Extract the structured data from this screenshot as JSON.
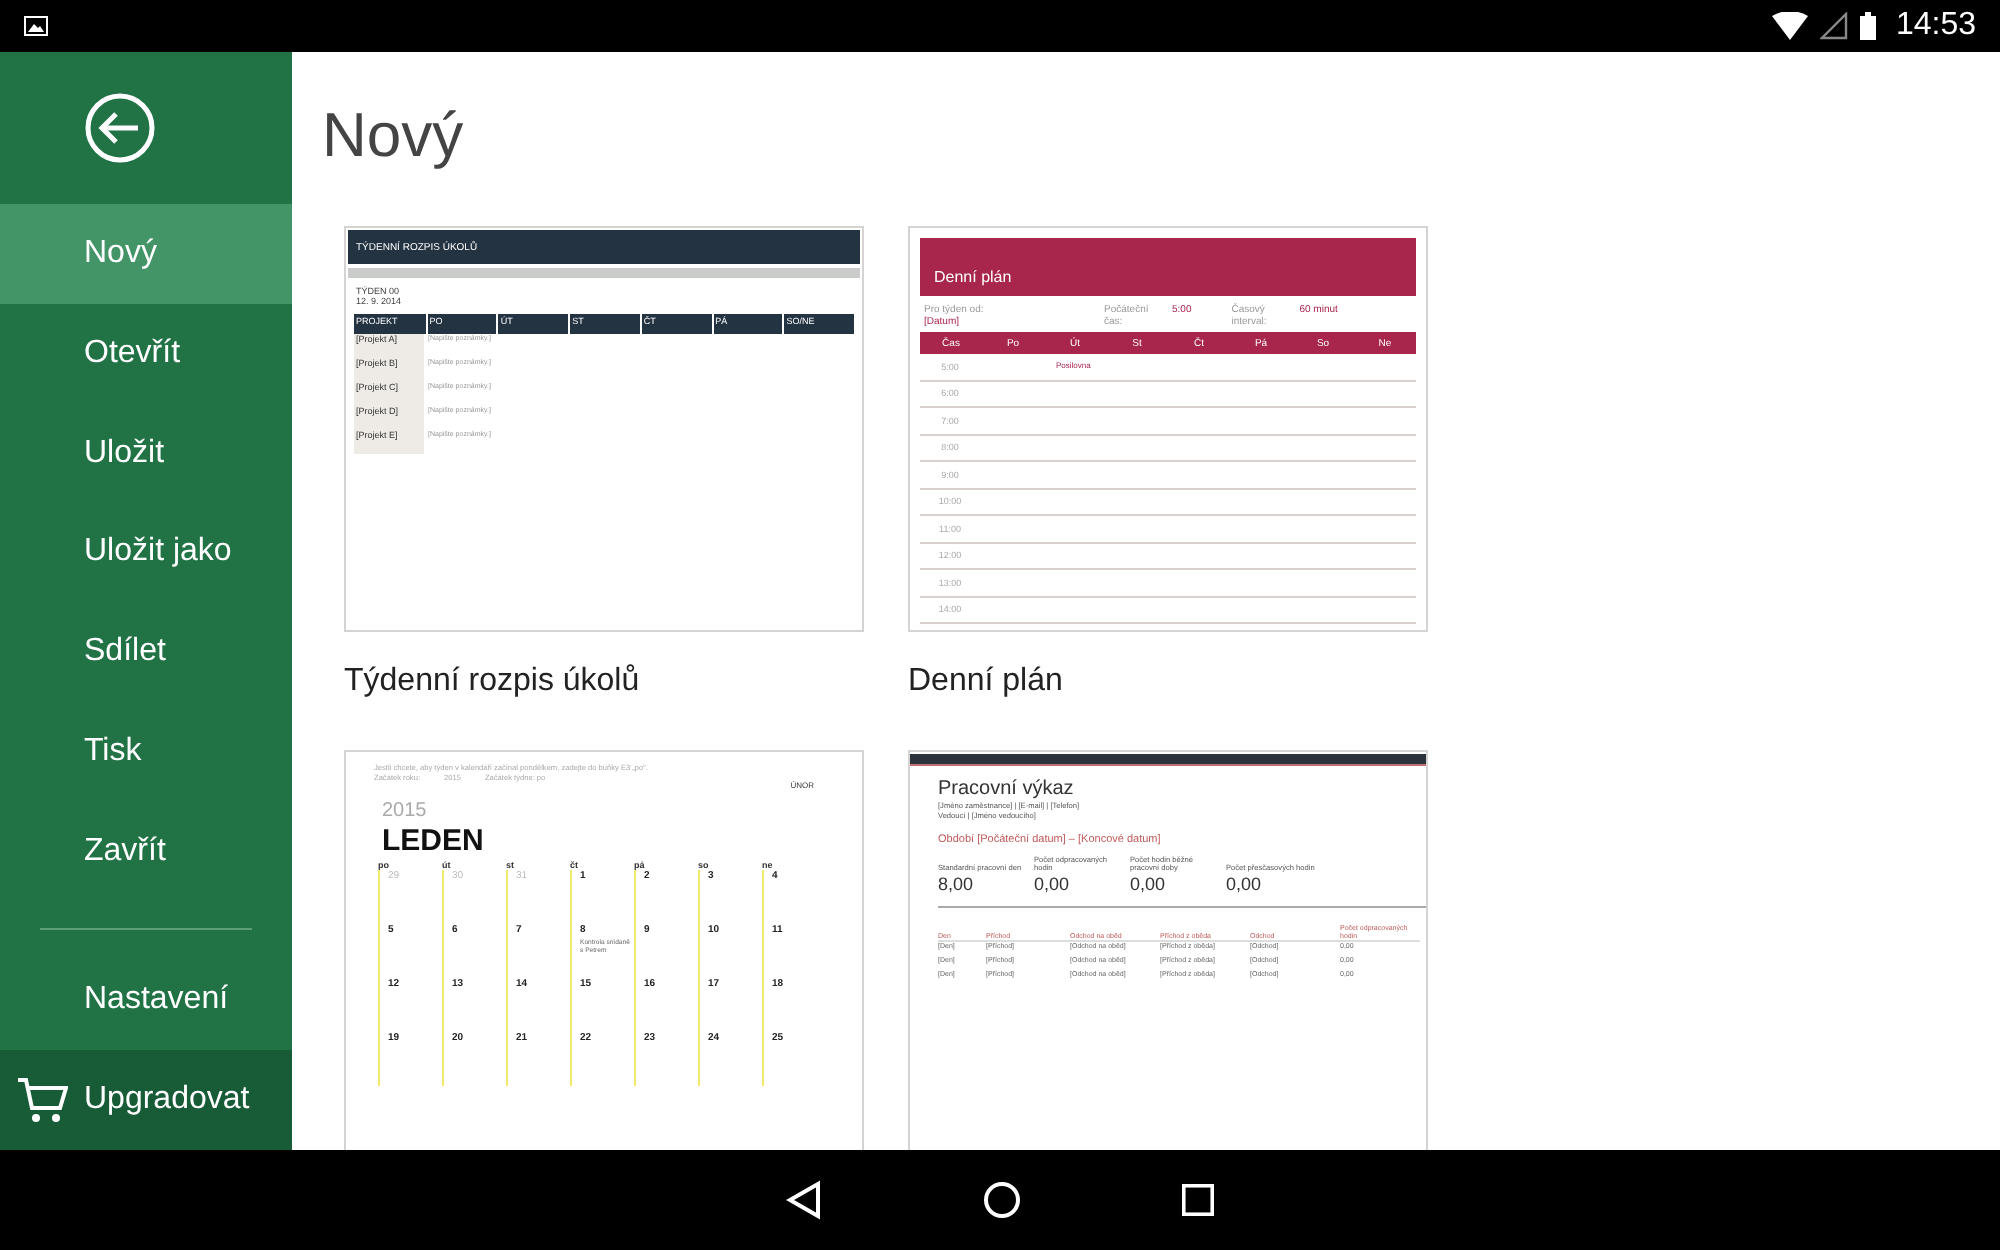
{
  "status_bar": {
    "time": "14:53"
  },
  "sidebar": {
    "items": [
      {
        "label": "Nový",
        "selected": true
      },
      {
        "label": "Otevřít",
        "selected": false
      },
      {
        "label": "Uložit",
        "selected": false
      },
      {
        "label": "Uložit jako",
        "selected": false
      },
      {
        "label": "Sdílet",
        "selected": false
      },
      {
        "label": "Tisk",
        "selected": false
      },
      {
        "label": "Zavřít",
        "selected": false
      }
    ],
    "settings": {
      "label": "Nastavení",
      "selected": false
    },
    "upgrade": {
      "label": "Upgradovat"
    }
  },
  "page_title": "Nový",
  "templates": [
    {
      "kind": "weekly",
      "name": "Týdenní rozpis úkolů",
      "title": "TÝDENNÍ ROZPIS ÚKOLŮ",
      "week": "TÝDEN 00",
      "date": "12. 9. 2014",
      "columns": [
        "PROJEKT",
        "PO",
        "ÚT",
        "ST",
        "ČT",
        "PÁ",
        "SO/NE"
      ],
      "rows": [
        {
          "project": "[Projekt A]",
          "note": "[Napište poznámky.]"
        },
        {
          "project": "[Projekt B]",
          "note": "[Napište poznámky.]"
        },
        {
          "project": "[Projekt C]",
          "note": "[Napište poznámky.]"
        },
        {
          "project": "[Projekt D]",
          "note": "[Napište poznámky.]"
        },
        {
          "project": "[Projekt E]",
          "note": "[Napište poznámky.]"
        }
      ]
    },
    {
      "kind": "daily",
      "name": "Denní plán",
      "title": "Denní plán",
      "week_label": "Pro týden od:",
      "week_value": "[Datum]",
      "start_label": "Počáteční čas:",
      "start_value": "5:00",
      "interval_label": "Časový interval:",
      "interval_value": "60 minut",
      "columns": [
        "Čas",
        "Po",
        "Út",
        "St",
        "Čt",
        "Pá",
        "So",
        "Ne"
      ],
      "times": [
        "5:00",
        "6:00",
        "7:00",
        "8:00",
        "9:00",
        "10:00",
        "11:00",
        "12:00",
        "13:00",
        "14:00"
      ],
      "entry": "Posilovna"
    },
    {
      "kind": "calendar",
      "hint": "Jestli chcete, aby týden v kalendáři začínal pondělkem, zadejte do buňky E3 „po“.",
      "year_label": "Začátek roku:",
      "year_value": "2015",
      "week_start": "Začátek týdne: po",
      "next_month": "ÚNOR",
      "year": "2015",
      "month": "LEDEN",
      "weekdays": [
        "po",
        "út",
        "st",
        "čt",
        "pá",
        "so",
        "ne"
      ],
      "weeks": [
        [
          {
            "day": "29",
            "muted": true
          },
          {
            "day": "30",
            "muted": true
          },
          {
            "day": "31",
            "muted": true
          },
          {
            "day": "1",
            "muted": false
          },
          {
            "day": "2",
            "muted": false
          },
          {
            "day": "3",
            "muted": false
          },
          {
            "day": "4",
            "muted": false
          }
        ],
        [
          {
            "day": "5",
            "muted": false
          },
          {
            "day": "6",
            "muted": false
          },
          {
            "day": "7",
            "muted": false
          },
          {
            "day": "8",
            "muted": false,
            "event": "Kontrola snídaně s Petrem"
          },
          {
            "day": "9",
            "muted": false
          },
          {
            "day": "10",
            "muted": false
          },
          {
            "day": "11",
            "muted": false
          }
        ],
        [
          {
            "day": "12",
            "muted": false
          },
          {
            "day": "13",
            "muted": false
          },
          {
            "day": "14",
            "muted": false
          },
          {
            "day": "15",
            "muted": false
          },
          {
            "day": "16",
            "muted": false
          },
          {
            "day": "17",
            "muted": false
          },
          {
            "day": "18",
            "muted": false
          }
        ],
        [
          {
            "day": "19",
            "muted": false
          },
          {
            "day": "20",
            "muted": false
          },
          {
            "day": "21",
            "muted": false
          },
          {
            "day": "22",
            "muted": false
          },
          {
            "day": "23",
            "muted": false
          },
          {
            "day": "24",
            "muted": false
          },
          {
            "day": "25",
            "muted": false
          }
        ]
      ]
    },
    {
      "kind": "timesheet",
      "title": "Pracovní výkaz",
      "contact": "[Jméno zaměstnance] | [E-mail] | [Telefon]",
      "manager": "Vedoucí | [Jméno vedoucího]",
      "period": "Období [Počáteční datum] – [Koncové datum]",
      "stats": [
        {
          "label": "Standardní pracovní den",
          "value": "8,00"
        },
        {
          "label": "Počet odpracovaných hodin",
          "value": "0,00"
        },
        {
          "label": "Počet hodin běžné pracovní doby",
          "value": "0,00"
        },
        {
          "label": "Počet přesčasových hodin",
          "value": "0,00"
        }
      ],
      "columns": [
        "Den",
        "Příchod",
        "Odchod na oběd",
        "Příchod z oběda",
        "Odchod",
        "Počet odpracovaných hodin"
      ],
      "rows": [
        [
          "[Den]",
          "[Příchod]",
          "[Odchod na oběd]",
          "[Příchod z oběda]",
          "[Odchod]",
          "0,00"
        ],
        [
          "[Den]",
          "[Příchod]",
          "[Odchod na oběd]",
          "[Příchod z oběda]",
          "[Odchod]",
          "0,00"
        ],
        [
          "[Den]",
          "[Příchod]",
          "[Odchod na oběd]",
          "[Příchod z oběda]",
          "[Odchod]",
          "0,00"
        ]
      ]
    }
  ]
}
